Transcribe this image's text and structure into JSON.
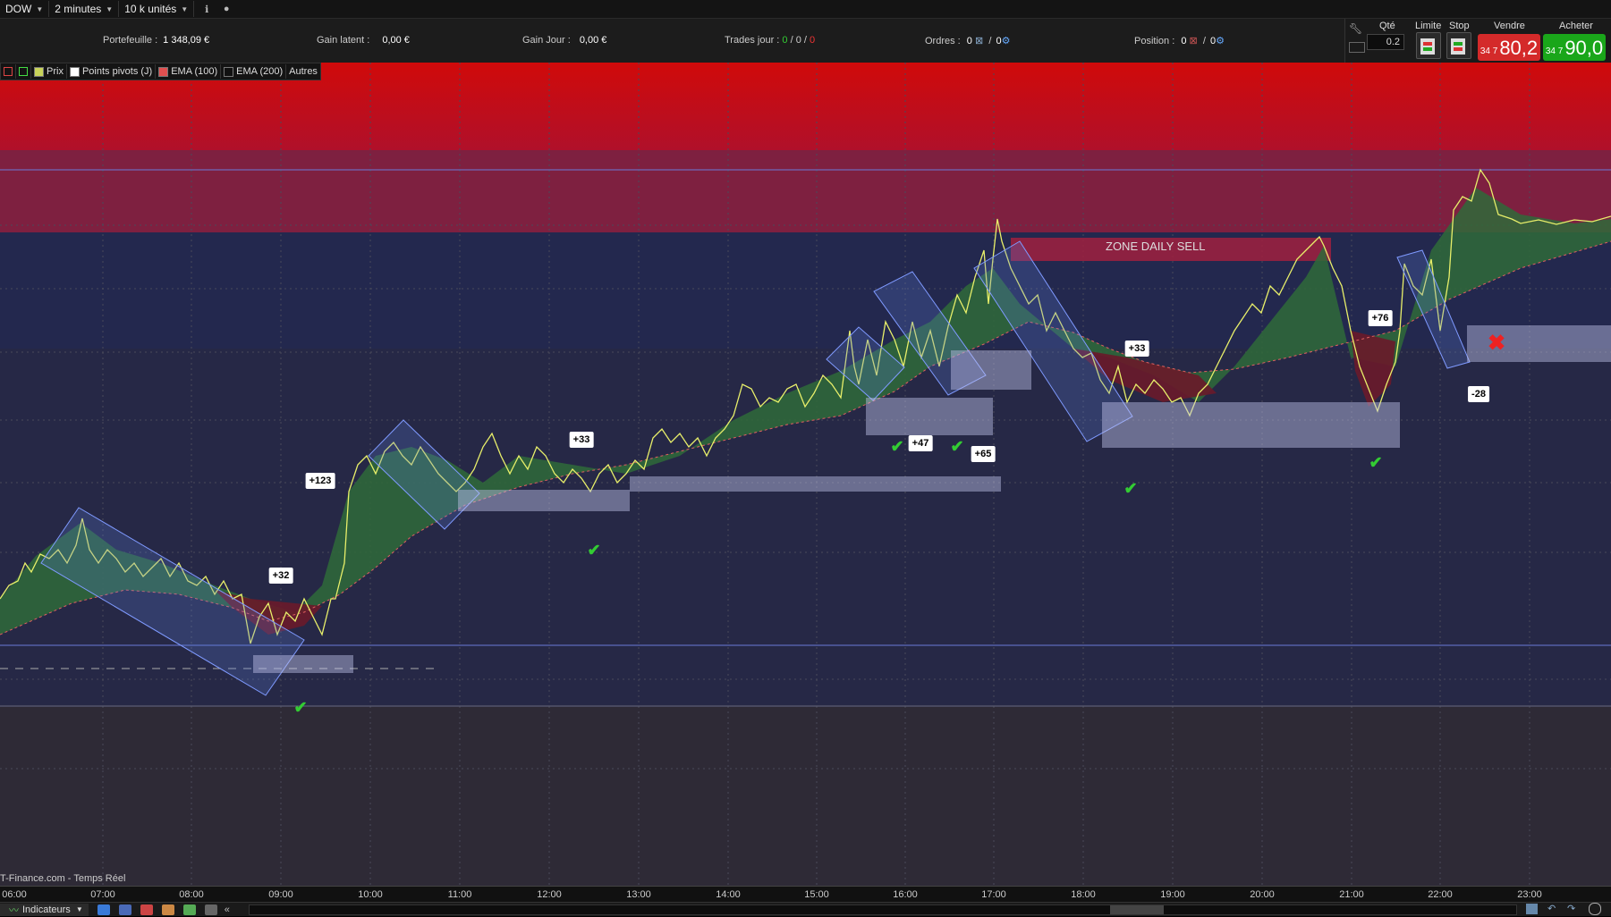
{
  "toolbar": {
    "symbol": "DOW",
    "timeframe": "2 minutes",
    "units": "10 k unités",
    "info_icon": "info-icon",
    "dot_icon": "status-dot-icon"
  },
  "account": {
    "portfolio_label": "Portefeuille :",
    "portfolio_value": "1 348,09 €",
    "latent_label": "Gain latent :",
    "latent_value": "0,00 €",
    "day_label": "Gain Jour :",
    "day_value": "0,00 €",
    "trades_label": "Trades jour :",
    "trades_a": "0",
    "trades_b": "0",
    "trades_c": "0",
    "orders_label": "Ordres :",
    "orders_a": "0",
    "orders_b": "0",
    "position_label": "Position :",
    "position_a": "0",
    "position_b": "0"
  },
  "trade_panel": {
    "qty_label": "Qté",
    "qty_value": "0.2",
    "limit_label": "Limite",
    "stop_label": "Stop",
    "sell_label": "Vendre",
    "sell_prefix": "34 7",
    "sell_price": "80,2",
    "buy_label": "Acheter",
    "buy_prefix": "34 7",
    "buy_price": "90,0",
    "colors": {
      "sell": "#d42a2a",
      "buy": "#1aa61a"
    }
  },
  "legend": {
    "items": [
      {
        "label": "Prix",
        "color": "#c8d45a"
      },
      {
        "label": "Points pivots (J)",
        "color": "#ffffff"
      },
      {
        "label": "EMA (100)",
        "color": "#e05050"
      },
      {
        "label": "EMA (200)",
        "color": "#111111"
      }
    ],
    "more": "Autres"
  },
  "chart": {
    "zone_label": "ZONE DAILY SELL",
    "source": "T-Finance.com - Temps Réel",
    "x_ticks": [
      "06:00",
      "07:00",
      "08:00",
      "09:00",
      "10:00",
      "11:00",
      "12:00",
      "13:00",
      "14:00",
      "15:00",
      "16:00",
      "17:00",
      "18:00",
      "19:00",
      "20:00",
      "21:00",
      "22:00",
      "23:00"
    ],
    "trade_labels": [
      "+32",
      "+123",
      "+33",
      "+47",
      "+65",
      "+33",
      "+76",
      "-28"
    ]
  },
  "bottom": {
    "indicators_label": "Indicateurs"
  }
}
